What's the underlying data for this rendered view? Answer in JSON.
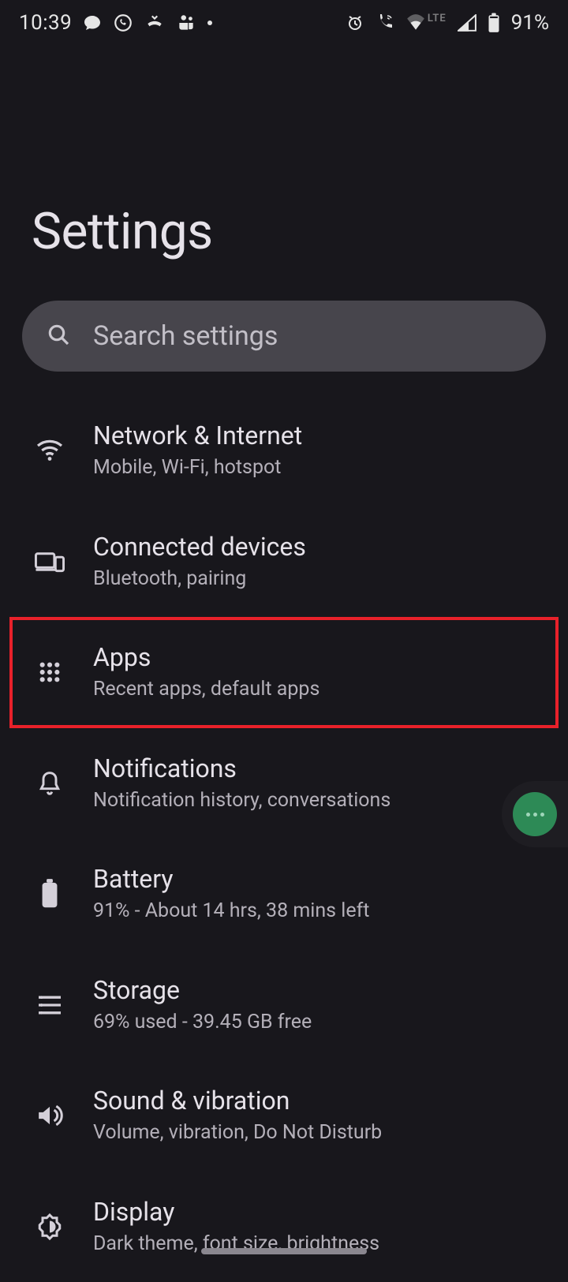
{
  "status": {
    "time": "10:39",
    "battery": "91%",
    "lte": "LTE"
  },
  "title": "Settings",
  "search": {
    "placeholder": "Search settings"
  },
  "items": [
    {
      "id": "network",
      "title": "Network & Internet",
      "sub": "Mobile, Wi-Fi, hotspot",
      "highlight": false
    },
    {
      "id": "devices",
      "title": "Connected devices",
      "sub": "Bluetooth, pairing",
      "highlight": false
    },
    {
      "id": "apps",
      "title": "Apps",
      "sub": "Recent apps, default apps",
      "highlight": true
    },
    {
      "id": "notif",
      "title": "Notifications",
      "sub": "Notification history, conversations",
      "highlight": false
    },
    {
      "id": "battery",
      "title": "Battery",
      "sub": "91% - About 14 hrs, 38 mins left",
      "highlight": false
    },
    {
      "id": "storage",
      "title": "Storage",
      "sub": "69% used - 39.45 GB free",
      "highlight": false
    },
    {
      "id": "sound",
      "title": "Sound & vibration",
      "sub": "Volume, vibration, Do Not Disturb",
      "highlight": false
    },
    {
      "id": "display",
      "title": "Display",
      "sub": "Dark theme, font size, brightness",
      "highlight": false
    }
  ]
}
